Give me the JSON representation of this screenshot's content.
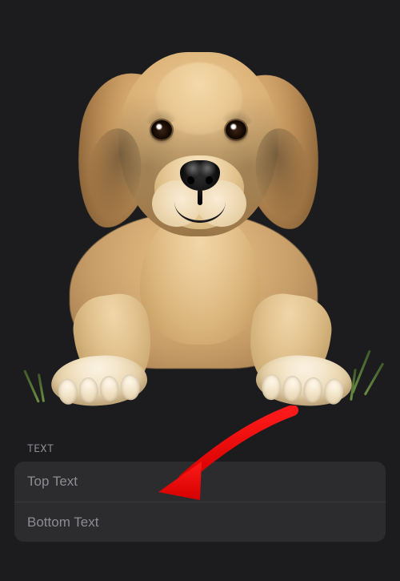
{
  "preview": {
    "subject": "golden-retriever-puppy"
  },
  "text_section": {
    "header": "TEXT",
    "top_placeholder": "Top Text",
    "top_value": "",
    "bottom_placeholder": "Bottom Text",
    "bottom_value": ""
  },
  "annotation": {
    "arrow_color": "#ff0000"
  },
  "colors": {
    "background": "#1c1c1e",
    "group_bg": "#2c2c2e",
    "separator": "#3a3a3c",
    "secondary_label": "#8d8d92"
  }
}
